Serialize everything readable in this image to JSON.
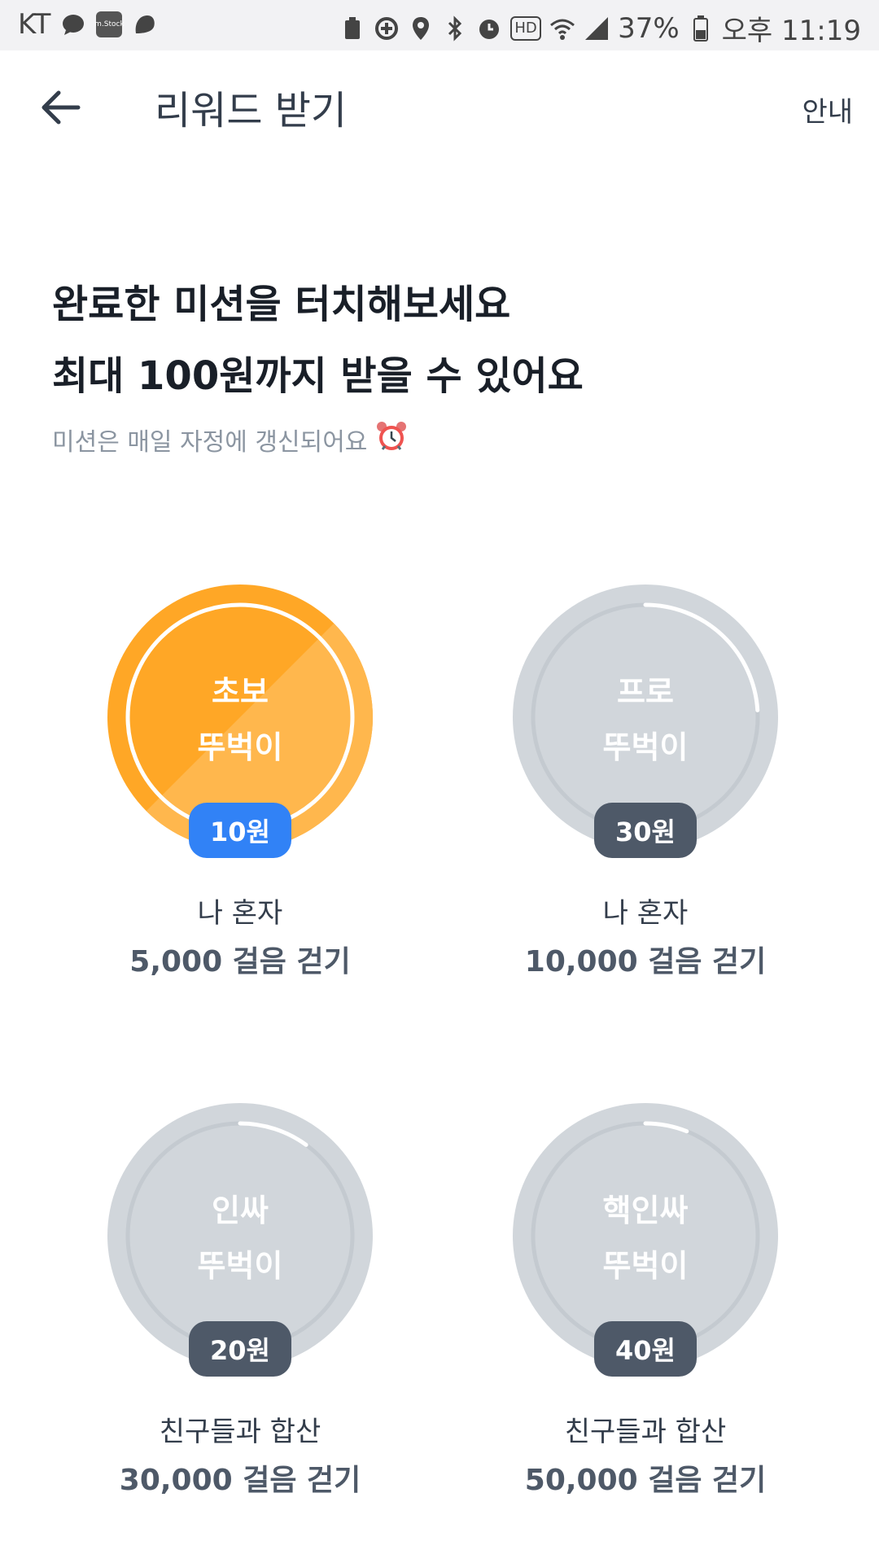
{
  "status_bar": {
    "carrier": "KT",
    "battery": "37%",
    "time": "오후 11:19",
    "mstock_label": "m.Stock",
    "hd_label": "HD",
    "icons": [
      "message-icon",
      "mstock-icon",
      "chat-icon",
      "battery-saver-icon",
      "data-saver-icon",
      "location-icon",
      "bluetooth-icon",
      "alarm-icon",
      "hd-icon",
      "wifi-icon",
      "signal-icon",
      "battery-icon"
    ]
  },
  "appbar": {
    "title": "리워드 받기",
    "guide_label": "안내"
  },
  "header": {
    "line1": "완료한 미션을 터치해보세요",
    "line2": "최대 100원까지 받을 수 있어요",
    "sub": "미션은 매일 자정에 갱신되어요",
    "sub_icon": "alarm-clock-icon"
  },
  "colors": {
    "active_circle": "#ffa726",
    "inactive_circle": "#d1d6db",
    "active_badge": "#3182f6",
    "inactive_badge": "#4e5968"
  },
  "missions": [
    {
      "name_line1": "초보",
      "name_line2": "뚜벅이",
      "reward": "10원",
      "desc1": "나 혼자",
      "desc2": "5,000 걸음 걷기",
      "completed": true,
      "progress": 1.0
    },
    {
      "name_line1": "프로",
      "name_line2": "뚜벅이",
      "reward": "30원",
      "desc1": "나 혼자",
      "desc2": "10,000 걸음 걷기",
      "completed": false,
      "progress": 0.24
    },
    {
      "name_line1": "인싸",
      "name_line2": "뚜벅이",
      "reward": "20원",
      "desc1": "친구들과 합산",
      "desc2": "30,000 걸음 걷기",
      "completed": false,
      "progress": 0.1
    },
    {
      "name_line1": "핵인싸",
      "name_line2": "뚜벅이",
      "reward": "40원",
      "desc1": "친구들과 합산",
      "desc2": "50,000 걸음 걷기",
      "completed": false,
      "progress": 0.06
    }
  ]
}
